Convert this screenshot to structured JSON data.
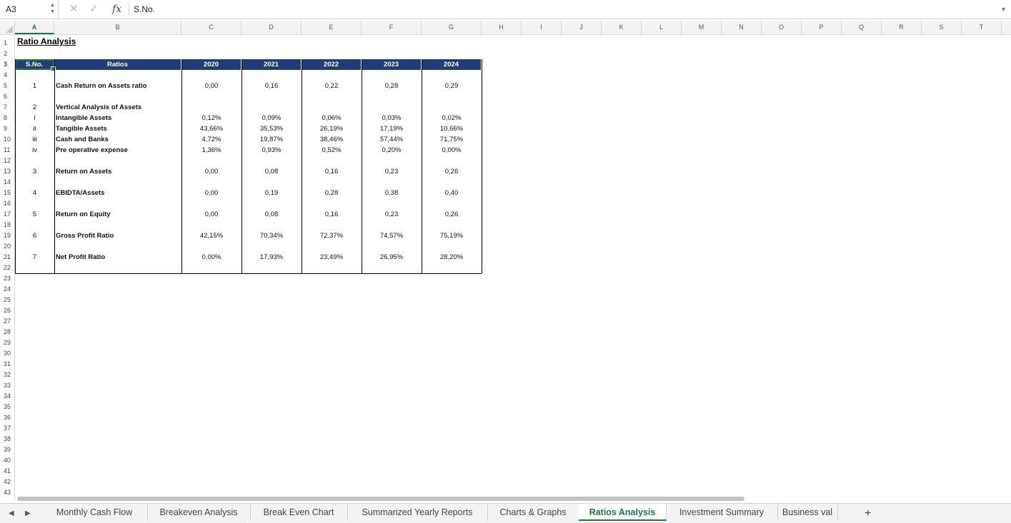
{
  "formula_bar": {
    "cell_ref": "A3",
    "fx_symbol": "fx",
    "cancel_symbol": "✕",
    "confirm_symbol": "✓",
    "value": "S.No."
  },
  "columns": [
    "A",
    "B",
    "C",
    "D",
    "E",
    "F",
    "G",
    "H",
    "I",
    "J",
    "K",
    "L",
    "M",
    "N",
    "O",
    "P",
    "Q",
    "R",
    "S",
    "T"
  ],
  "active_column": "A",
  "active_row": 3,
  "row_numbers": [
    "1",
    "2",
    "3",
    "4",
    "5",
    "6",
    "7",
    "8",
    "9",
    "10",
    "11",
    "12",
    "13",
    "14",
    "15",
    "16",
    "17",
    "18",
    "19",
    "20",
    "21",
    "22",
    "23",
    "24",
    "25",
    "26",
    "27",
    "28",
    "29",
    "30",
    "31",
    "32",
    "33",
    "34",
    "35",
    "36",
    "37",
    "38",
    "39",
    "40",
    "41",
    "42",
    "43"
  ],
  "sheet": {
    "title": "Ratio Analysis",
    "header": {
      "sno": "S.No.",
      "ratios": "Ratios",
      "years": [
        "2020",
        "2021",
        "2022",
        "2023",
        "2024"
      ]
    },
    "rows": [
      {
        "row": 5,
        "sno": "1",
        "label": "Cash Return on Assets ratio",
        "values": [
          "0,00",
          "0,16",
          "0,22",
          "0,28",
          "0,29"
        ]
      },
      {
        "row": 7,
        "sno": "2",
        "label": "Vertical Analysis of Assets",
        "values": [
          "",
          "",
          "",
          "",
          ""
        ]
      },
      {
        "row": 8,
        "sno": "i",
        "label": "Intangible Assets",
        "values": [
          "0,12%",
          "0,09%",
          "0,06%",
          "0,03%",
          "0,02%"
        ]
      },
      {
        "row": 9,
        "sno": "ii",
        "label": "Tangible Assets",
        "values": [
          "43,66%",
          "35,53%",
          "26,19%",
          "17,19%",
          "10,66%"
        ]
      },
      {
        "row": 10,
        "sno": "iii",
        "label": "Cash and Banks",
        "values": [
          "4,72%",
          "19,87%",
          "38,46%",
          "57,44%",
          "71,75%"
        ]
      },
      {
        "row": 11,
        "sno": "iv",
        "label": "Pre operative expense",
        "values": [
          "1,36%",
          "0,93%",
          "0,52%",
          "0,20%",
          "0,00%"
        ]
      },
      {
        "row": 13,
        "sno": "3",
        "label": "Return on Assets",
        "values": [
          "0,00",
          "0,08",
          "0,16",
          "0,23",
          "0,26"
        ]
      },
      {
        "row": 15,
        "sno": "4",
        "label": "EBIDTA/Assets",
        "values": [
          "0,00",
          "0,19",
          "0,28",
          "0,38",
          "0,40"
        ]
      },
      {
        "row": 17,
        "sno": "5",
        "label": "Return on Equity",
        "values": [
          "0,00",
          "0,08",
          "0,16",
          "0,23",
          "0,26"
        ]
      },
      {
        "row": 19,
        "sno": "6",
        "label": "Gross Profit Ratio",
        "values": [
          "42,15%",
          "70,34%",
          "72,37%",
          "74,57%",
          "75,19%"
        ]
      },
      {
        "row": 21,
        "sno": "7",
        "label": "Net Profit Ratio",
        "values": [
          "0,00%",
          "17,93%",
          "23,49%",
          "26,95%",
          "28,20%"
        ]
      }
    ]
  },
  "tabs": [
    "Monthly Cash Flow",
    "Breakeven Analysis",
    "Break Even Chart",
    "Summarized Yearly Reports",
    "Charts & Graphs",
    "Ratios Analysis",
    "Investment Summary",
    "Business val"
  ],
  "active_tab": "Ratios Analysis",
  "tab_nav": {
    "prev": "◀",
    "next": "▶",
    "add": "+"
  },
  "colors": {
    "accent": "#217346",
    "header_fill": "#1f3e77"
  }
}
